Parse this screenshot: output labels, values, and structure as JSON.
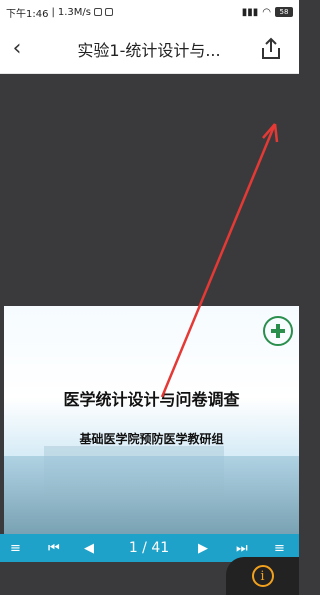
{
  "status_bar": {
    "time": "下午1:46",
    "speed": "1.3M/s",
    "battery": "58"
  },
  "header": {
    "title": "实验1-统计设计与...",
    "back_icon": "back-chevron-icon",
    "share_icon": "share-icon"
  },
  "slide": {
    "title": "医学统计设计与问卷调查",
    "subtitle": "基础医学院预防医学教研组"
  },
  "nav": {
    "page_indicator": "1 / 41"
  },
  "info_button": {
    "icon": "info-icon",
    "color": "#f2a11d"
  },
  "colors": {
    "nav_bar": "#1ea2c9",
    "annotation_arrow": "#e53935"
  }
}
